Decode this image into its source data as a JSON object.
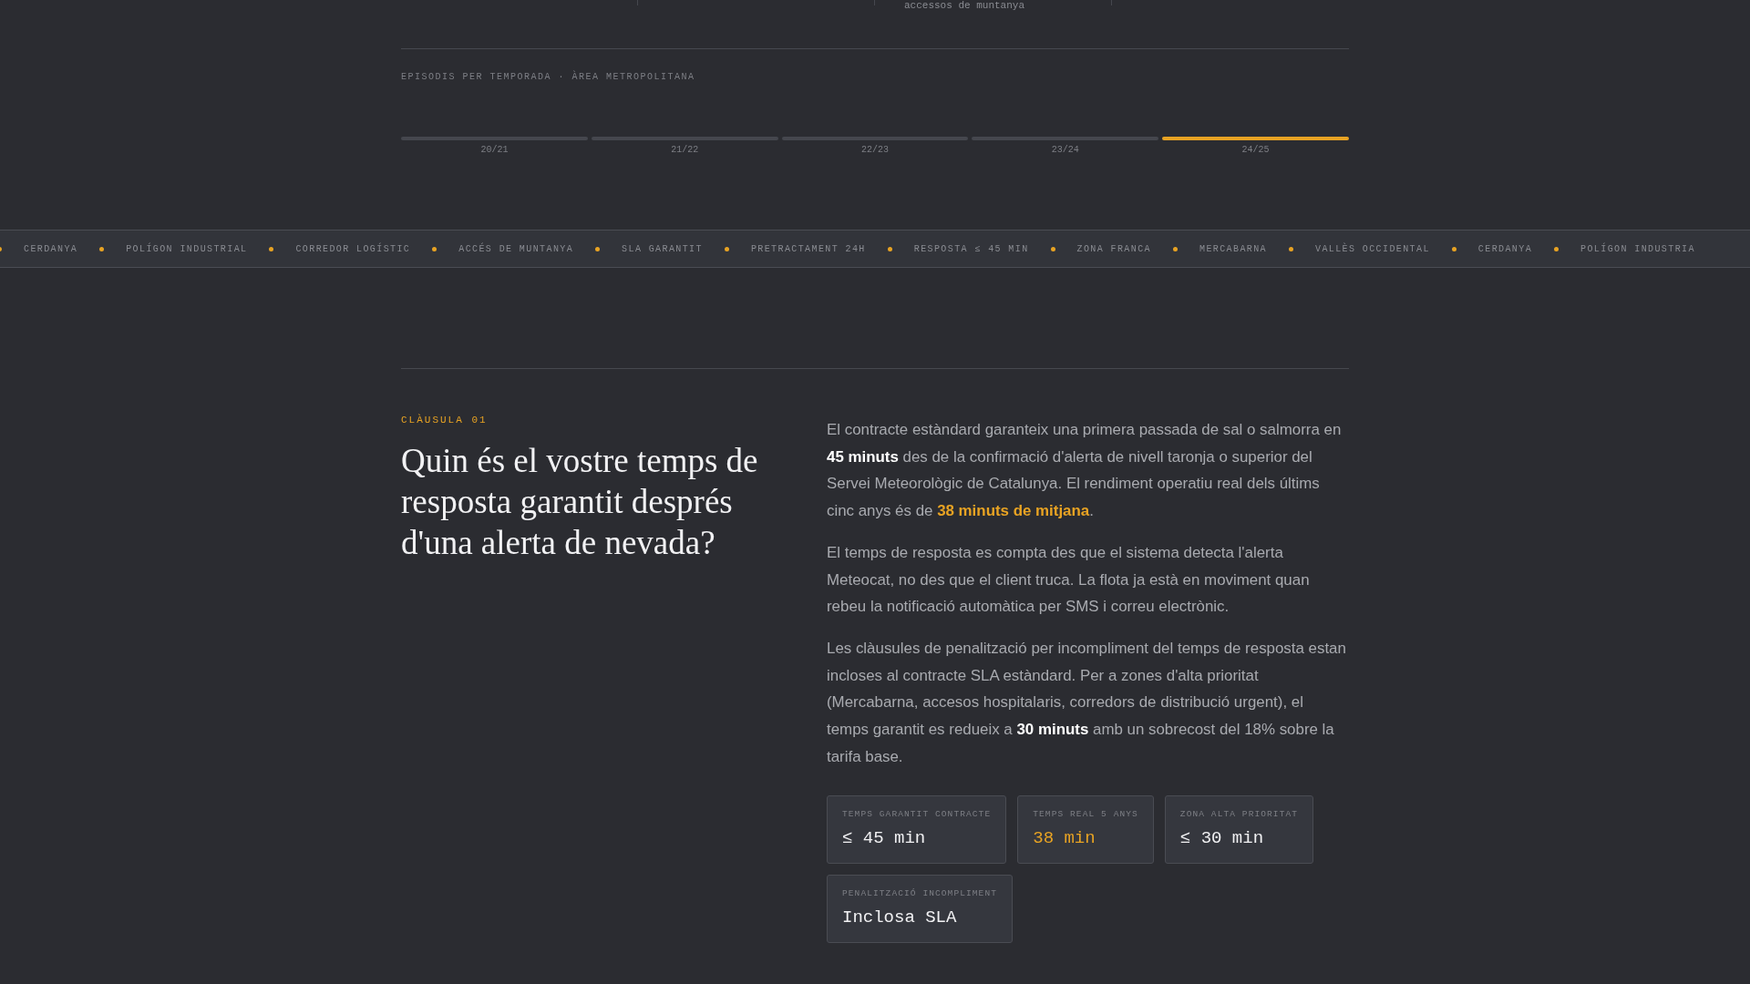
{
  "top_strip": {
    "cells": [
      "",
      "",
      "accessos de muntanya",
      ""
    ]
  },
  "season_chart": {
    "title": "EPISODIS PER TEMPORADA · ÀREA METROPOLITANA",
    "seasons": [
      {
        "label": "20/21",
        "selected": false
      },
      {
        "label": "21/22",
        "selected": false
      },
      {
        "label": "22/23",
        "selected": false
      },
      {
        "label": "23/24",
        "selected": false
      },
      {
        "label": "24/25",
        "selected": true
      }
    ]
  },
  "ticker": [
    "CERDANYA",
    "POLÍGON INDUSTRIAL",
    "CORREDOR LOGÍSTIC",
    "ACCÉS DE MUNTANYA",
    "SLA GARANTIT",
    "PRETRACTAMENT 24H",
    "RESPOSTA ≤ 45 MIN",
    "ZONA FRANCA",
    "MERCABARNA",
    "VALLÈS OCCIDENTAL",
    "CERDANYA",
    "POLÍGON INDUSTRIA"
  ],
  "clause": {
    "eyebrow": "CLÀUSULA 01",
    "question": "Quin és el vostre temps de resposta garantit després d'una alerta de nevada?",
    "paragraphs": [
      "El contracte estàndard garanteix una primera passada de sal o salmorra en **45 minuts** des de la confirmació d'alerta de nivell taronja o superior del Servei Meteorològic de Catalunya. El rendiment operatiu real dels últims cinc anys és de *38 minuts de mitjana*.",
      "El temps de resposta es compta des que el sistema detecta l'alerta Meteocat, no des que el client truca. La flota ja està en moviment quan rebeu la notificació automàtica per SMS i correu electrònic.",
      "Les clàusules de penalització per incompliment del temps de resposta estan incloses al contracte SLA estàndard. Per a zones d'alta prioritat (Mercabarna, accesos hospitalaris, corredors de distribució urgent), el temps garantit es redueix a **30 minuts** amb un sobrecost del 18% sobre la tarifa base."
    ],
    "stats": [
      {
        "label": "TEMPS GARANTIT CONTRACTE",
        "value": "≤ 45 min",
        "highlight": false
      },
      {
        "label": "TEMPS REAL 5 ANYS",
        "value": "38 min",
        "highlight": true
      },
      {
        "label": "ZONA ALTA PRIORITAT",
        "value": "≤ 30 min",
        "highlight": false
      },
      {
        "label": "PENALITZACIÓ INCOMPLIMENT",
        "value": "Inclosa SLA",
        "highlight": false
      }
    ]
  }
}
